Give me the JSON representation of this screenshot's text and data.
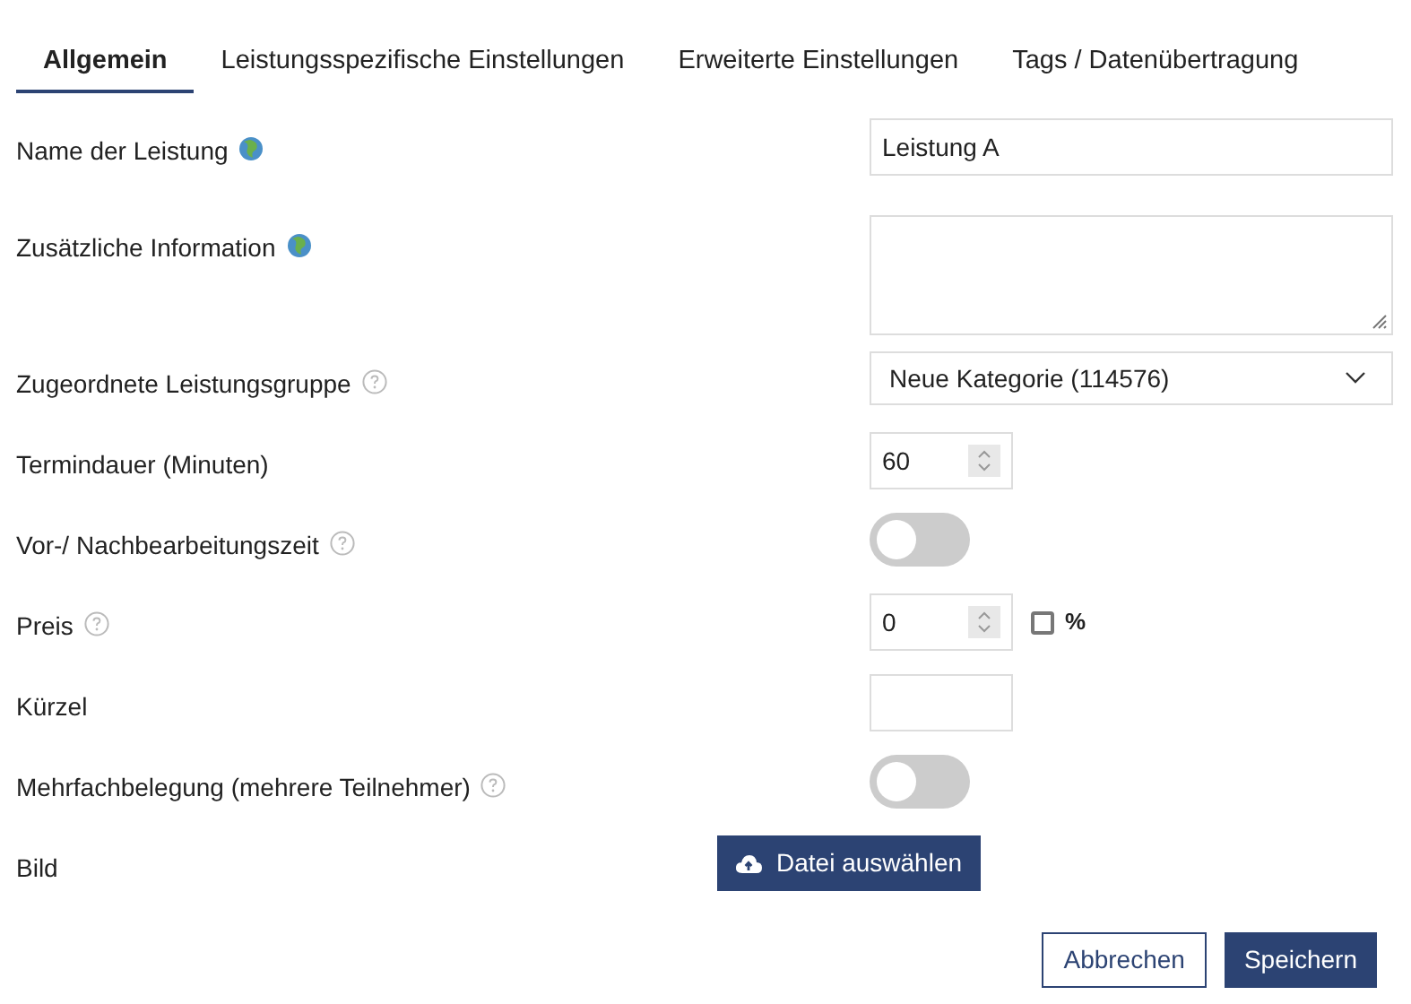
{
  "tabs": [
    {
      "label": "Allgemein",
      "selected": true
    },
    {
      "label": "Leistungsspezifische Einstellungen",
      "selected": false
    },
    {
      "label": "Erweiterte Einstellungen",
      "selected": false
    },
    {
      "label": "Tags / Datenübertragung",
      "selected": false
    }
  ],
  "fields": [
    {
      "kind": "text",
      "label": "Name der Leistung",
      "translatable": true,
      "help": false,
      "value": "Leistung A"
    },
    {
      "kind": "textarea",
      "label": "Zusätzliche Information",
      "translatable": true,
      "help": false
    },
    {
      "kind": "select",
      "label": "Zugeordnete Leistungsgruppe",
      "translatable": false,
      "help": true,
      "value": "Neue Kategorie (114576)"
    },
    {
      "kind": "number",
      "label": "Termindauer (Minuten)",
      "translatable": false,
      "help": false,
      "value": "60"
    },
    {
      "kind": "toggle",
      "label": "Vor-/ Nachbearbeitungszeit",
      "translatable": false,
      "help": true,
      "on": false
    },
    {
      "kind": "number",
      "label": "Preis",
      "translatable": false,
      "help": true,
      "value": "0",
      "percent": {
        "label": "%",
        "checked": false
      }
    },
    {
      "kind": "short_text",
      "label": "Kürzel",
      "translatable": false,
      "help": false
    },
    {
      "kind": "toggle",
      "label": "Mehrfachbelegung (mehrere Teilnehmer)",
      "translatable": false,
      "help": true,
      "on": false
    },
    {
      "kind": "file",
      "label": "Bild",
      "translatable": false,
      "help": false,
      "button": "Datei auswählen"
    }
  ],
  "footer": {
    "cancel": "Abbrechen",
    "save": "Speichern"
  }
}
